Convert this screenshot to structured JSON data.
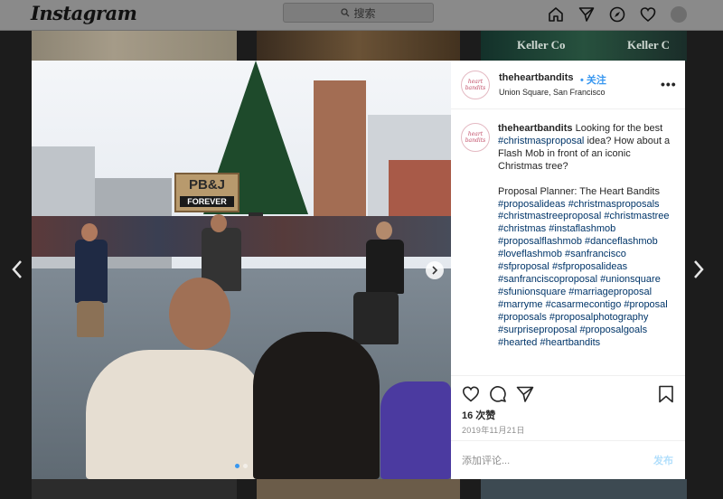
{
  "nav": {
    "logo": "Instagram",
    "search_placeholder": "搜索",
    "icons": [
      "home-icon",
      "direct-icon",
      "explore-icon",
      "heart-icon",
      "profile-avatar"
    ]
  },
  "background": {
    "tile3_text": "Keller Co",
    "tile3_text2": "Keller C"
  },
  "photo": {
    "sign_text": "PB&J",
    "sign_sub": "FOREVER",
    "carousel_count": 2,
    "carousel_active": 1
  },
  "post": {
    "avatar_text": "heart bandits",
    "username": "theheartbandits",
    "follow_sep": "•",
    "follow_label": "关注",
    "location": "Union Square, San Francisco",
    "more": "•••",
    "caption_user": "theheartbandits",
    "caption_text_1": "Looking for the best",
    "caption_tag_1": "#christmasproposal",
    "caption_text_2": "idea? How about a Flash Mob in front of an iconic Christmas tree?",
    "planner": "Proposal Planner: The Heart Bandits",
    "hashtags": [
      "#proposalideas",
      "#christmasproposals",
      "#christmastreeproposal",
      "#christmastree",
      "#christmas",
      "#instaflashmob",
      "#proposalflashmob",
      "#danceflashmob",
      "#loveflashmob",
      "#sanfrancisco",
      "#sfproposal",
      "#sfproposalideas",
      "#sanfranciscoproposal",
      "#unionsquare",
      "#sfunionsquare",
      "#marriageproposal",
      "#marryme",
      "#casarmecontigo",
      "#proposal",
      "#proposals",
      "#proposalphotography",
      "#surpriseproposal",
      "#proposalgoals",
      "#hearted",
      "#heartbandits"
    ],
    "likes": "16 次赞",
    "date": "2019年11月21日",
    "comment_placeholder": "添加评论...",
    "post_label": "发布"
  },
  "colors": {
    "accent": "#3897f0",
    "tag": "#003569",
    "post_disabled": "#b2dffc"
  }
}
